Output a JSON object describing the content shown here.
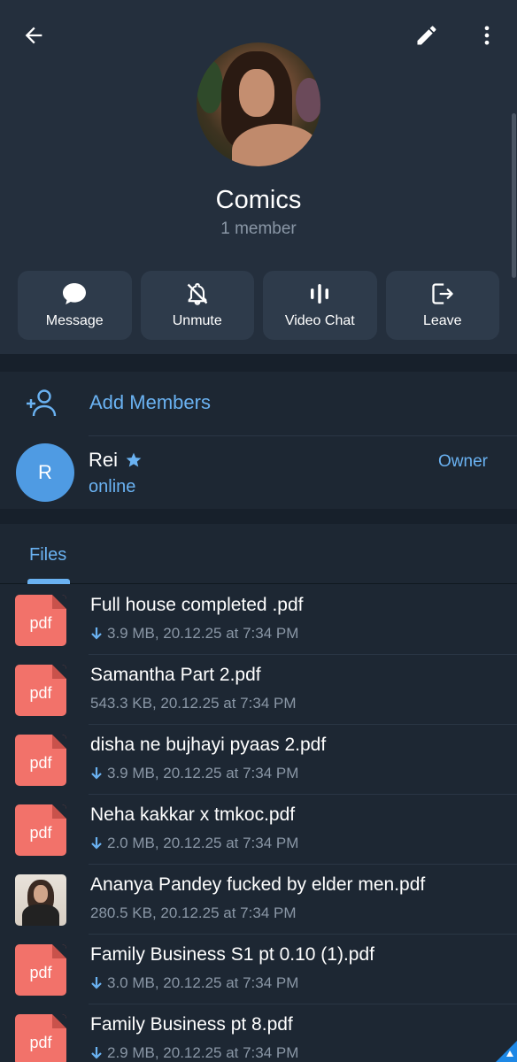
{
  "header": {
    "title": "Comics",
    "subtitle": "1 member"
  },
  "icons": {
    "back": "arrow-left-icon",
    "edit": "pencil-icon",
    "more": "more-vertical-icon"
  },
  "actions": [
    {
      "label": "Message",
      "icon": "chat-bubble-icon"
    },
    {
      "label": "Unmute",
      "icon": "bell-off-icon"
    },
    {
      "label": "Video Chat",
      "icon": "voice-chat-icon"
    },
    {
      "label": "Leave",
      "icon": "leave-icon"
    }
  ],
  "add_members": {
    "label": "Add Members",
    "icon": "add-user-icon"
  },
  "member": {
    "initial": "R",
    "name": "Rei",
    "status": "online",
    "role": "Owner",
    "badge_icon": "star-icon"
  },
  "tabs": {
    "files": "Files"
  },
  "files": [
    {
      "name": "Full house completed .pdf",
      "meta": "3.9 MB, 20.12.25 at 7:34 PM",
      "downloadable": true,
      "type": "pdf"
    },
    {
      "name": "Samantha Part 2.pdf",
      "meta": "543.3 KB, 20.12.25 at 7:34 PM",
      "downloadable": false,
      "type": "pdf"
    },
    {
      "name": "disha ne bujhayi pyaas 2.pdf",
      "meta": "3.9 MB, 20.12.25 at 7:34 PM",
      "downloadable": true,
      "type": "pdf"
    },
    {
      "name": "Neha kakkar x tmkoc.pdf",
      "meta": "2.0 MB, 20.12.25 at 7:34 PM",
      "downloadable": true,
      "type": "pdf"
    },
    {
      "name": "Ananya Pandey fucked by elder men.pdf",
      "meta": "280.5 KB, 20.12.25 at 7:34 PM",
      "downloadable": false,
      "type": "thumbnail"
    },
    {
      "name": "Family Business S1 pt 0.10 (1).pdf",
      "meta": "3.0 MB, 20.12.25 at 7:34 PM",
      "downloadable": true,
      "type": "pdf"
    },
    {
      "name": "Family Business pt 8.pdf",
      "meta": "2.9 MB, 20.12.25 at 7:34 PM",
      "downloadable": true,
      "type": "pdf"
    }
  ],
  "file_icon_ext": "pdf",
  "colors": {
    "accent": "#6ab2f2",
    "pdf": "#f2726a",
    "background": "#1d2733",
    "header": "#242f3d"
  }
}
